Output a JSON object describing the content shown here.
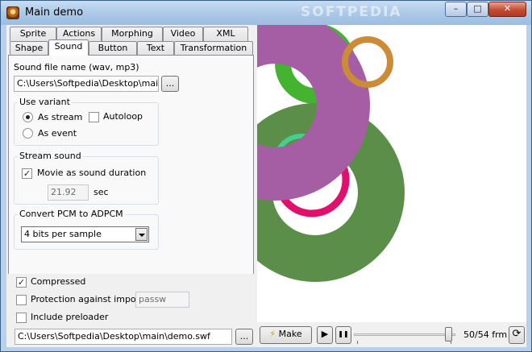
{
  "window": {
    "title": "Main demo",
    "watermark": "SOFTPEDIA",
    "controls": {
      "minimize": "–",
      "maximize": "□",
      "close": "✕"
    }
  },
  "tabs_row1": [
    "Sprite",
    "Actions",
    "Morphing",
    "Video",
    "XML"
  ],
  "tabs_row2": [
    "Shape",
    "Sound",
    "Button",
    "Text",
    "Transformation"
  ],
  "active_tab": "Sound",
  "sound": {
    "file_label": "Sound file name (wav, mp3)",
    "file_value": "C:\\Users\\Softpedia\\Desktop\\main\\st",
    "browse_label": "...",
    "use_variant": {
      "title": "Use variant",
      "as_stream": "As stream",
      "as_event": "As event",
      "autoloop": "Autoloop",
      "selected": "as_stream",
      "autoloop_checked": false
    },
    "stream_sound": {
      "title": "Stream sound",
      "movie_duration": "Movie as sound duration",
      "movie_duration_checked": true,
      "seconds_value": "21.92",
      "seconds_unit": "sec"
    },
    "convert": {
      "title": "Convert PCM to ADPCM",
      "selected": "4 bits per sample"
    }
  },
  "options": {
    "compressed": "Compressed",
    "compressed_checked": true,
    "protection": "Protection against import",
    "protection_checked": false,
    "password_placeholder": "passw",
    "preloader": "Include preloader",
    "preloader_checked": false
  },
  "output": {
    "path": "C:\\Users\\Softpedia\\Desktop\\main\\demo.swf",
    "browse_label": "..."
  },
  "toolbar": {
    "make_label": "Make",
    "play_symbol": "▶",
    "pause_symbol": "❚❚",
    "frame_text": "50/54 frm",
    "frame_position": 0.926,
    "refresh_symbol": "⟳"
  },
  "colors": {
    "ring_purple": "#a55ea3",
    "ring_green": "#5b8f49",
    "ring_bright_green": "#44b32f",
    "ring_orange": "#cc8b36",
    "ring_pink": "#e0106c",
    "ring_mint": "#44cf8f"
  }
}
